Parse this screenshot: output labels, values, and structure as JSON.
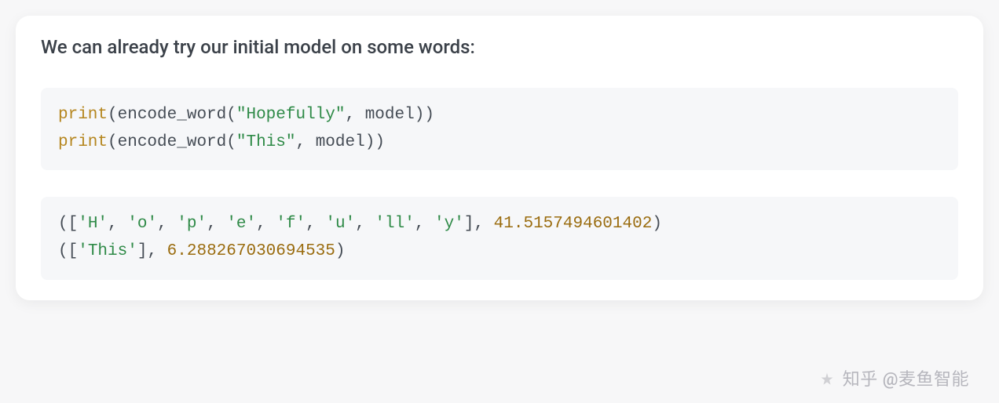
{
  "intro_text": "We can already try our initial model on some words:",
  "code_input": {
    "line1": {
      "fn": "print",
      "arg_fn": "encode_word",
      "str": "\"Hopefully\"",
      "arg2": "model"
    },
    "line2": {
      "fn": "print",
      "arg_fn": "encode_word",
      "str": "\"This\"",
      "arg2": "model"
    }
  },
  "code_output": {
    "line1": {
      "tokens": [
        "'H'",
        "'o'",
        "'p'",
        "'e'",
        "'f'",
        "'u'",
        "'ll'",
        "'y'"
      ],
      "score": "41.5157494601402"
    },
    "line2": {
      "tokens": [
        "'This'"
      ],
      "score": "6.288267030694535"
    }
  },
  "watermark": {
    "brand": "知乎",
    "user": "@麦鱼智能"
  }
}
